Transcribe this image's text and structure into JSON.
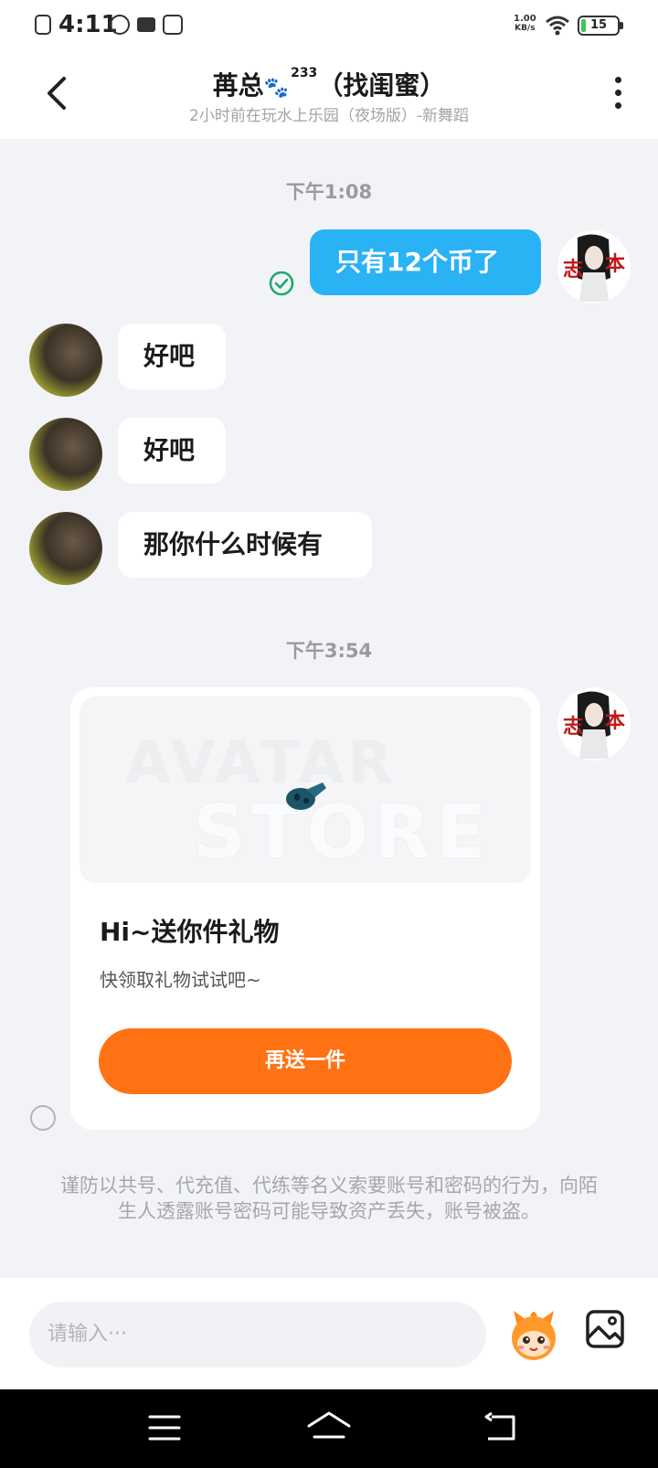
{
  "status_bar": {
    "time": "4:11",
    "network_speed_value": "1.00",
    "network_speed_unit": "KB/s",
    "battery": "15"
  },
  "header": {
    "title": "苒总",
    "title_suffix": "233",
    "title_tag": "（找闺蜜）",
    "subtitle": "2小时前在玩水上乐园（夜场版）-新舞蹈"
  },
  "messages": {
    "timestamp_1": "下午1:08",
    "sent_1": "只有12个币了",
    "recv_1": "好吧",
    "recv_2": "好吧",
    "recv_3": "那你什么时候有",
    "timestamp_2": "下午3:54"
  },
  "gift_card": {
    "watermark_1": "AVATAR",
    "watermark_2": "STORE",
    "title": "Hi~送你件礼物",
    "subtitle": "快领取礼物试试吧~",
    "button_label": "再送一件"
  },
  "notice": "谨防以共号、代充值、代练等名义索要账号和密码的行为，向陌生人透露账号密码可能导致资产丢失，账号被盗。",
  "input": {
    "placeholder": "请输入···"
  },
  "colors": {
    "sent_bubble": "#29b3f5",
    "button_orange": "#ff7214",
    "read_check": "#1aa86a"
  }
}
